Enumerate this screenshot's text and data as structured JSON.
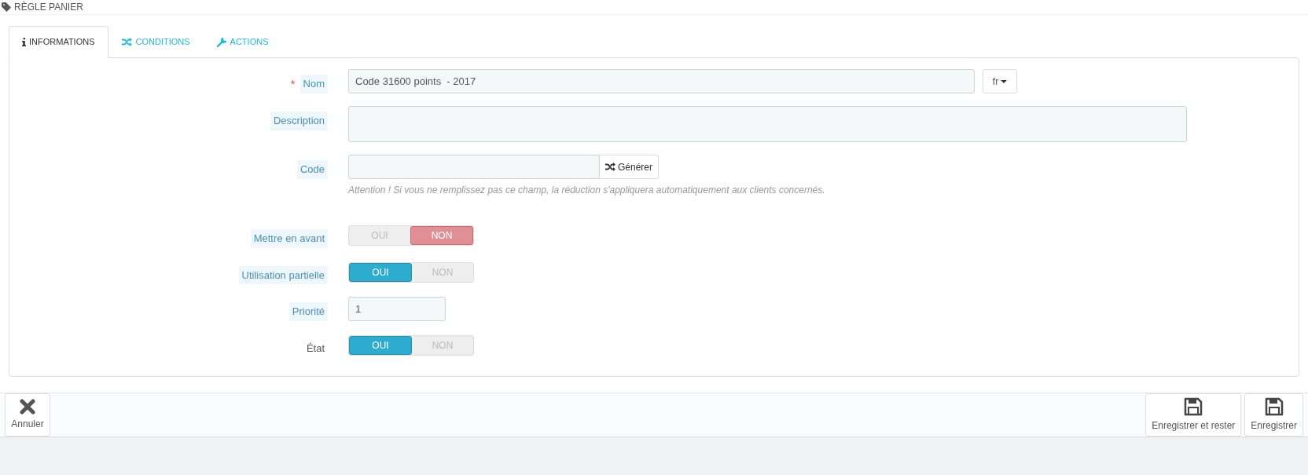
{
  "page_title": "RÈGLE PANIER",
  "tabs": [
    {
      "label": "INFORMATIONS",
      "selected": true
    },
    {
      "label": "CONDITIONS",
      "selected": false
    },
    {
      "label": "ACTIONS",
      "selected": false
    }
  ],
  "fields": [
    {
      "kind": "text",
      "label": "Nom",
      "required_mark": "*",
      "hint": true,
      "value": "Code 31600 points  - 2017",
      "language": "fr"
    },
    {
      "kind": "textarea",
      "label": "Description",
      "hint": true
    },
    {
      "kind": "code",
      "label": "Code",
      "hint": true,
      "button": "Générer",
      "help": "Attention ! Si vous ne remplissez pas ce champ, la réduction s'appliquera automatiquement aux clients concernés."
    },
    {
      "kind": "switch",
      "label": "Mettre en avant",
      "hint": true,
      "options": [
        {
          "label": "OUI",
          "selected": false
        },
        {
          "label": "NON",
          "selected": true
        }
      ]
    },
    {
      "kind": "switch",
      "label": "Utilisation partielle",
      "hint": true,
      "options": [
        {
          "label": "OUI",
          "selected": true
        },
        {
          "label": "NON",
          "selected": false
        }
      ]
    },
    {
      "kind": "small",
      "label": "Priorité",
      "hint": true,
      "value": "1"
    },
    {
      "kind": "switch",
      "label": "État",
      "hint": false,
      "options": [
        {
          "label": "OUI",
          "selected": true
        },
        {
          "label": "NON",
          "selected": false
        }
      ]
    }
  ],
  "footer": {
    "left": [
      {
        "label": "Annuler"
      }
    ],
    "right": [
      {
        "label": "Enregistrer et rester"
      },
      {
        "label": "Enregistrer"
      }
    ]
  }
}
